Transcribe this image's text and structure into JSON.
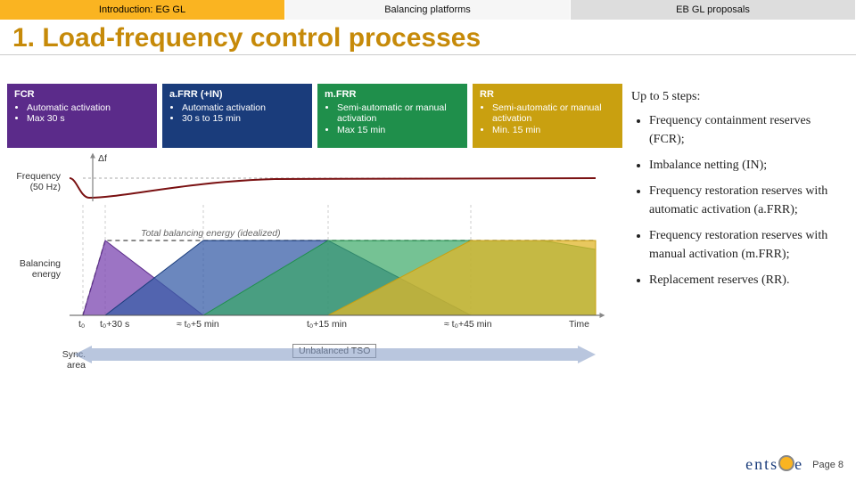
{
  "tabs": {
    "intro": "Introduction: EG GL",
    "balancing": "Balancing platforms",
    "eb": "EB GL proposals"
  },
  "title": "1. Load-frequency control processes",
  "boxes": {
    "fcr": {
      "title": "FCR",
      "b1": "Automatic activation",
      "b2": "Max 30 s"
    },
    "afrr": {
      "title": "a.FRR (+IN)",
      "b1": "Automatic activation",
      "b2": "30 s to 15 min"
    },
    "mfrr": {
      "title": "m.FRR",
      "b1": "Semi-automatic or manual activation",
      "b2": "Max 15 min"
    },
    "rr": {
      "title": "RR",
      "b1": "Semi-automatic or manual activation",
      "b2": "Min. 15 min"
    }
  },
  "diagram": {
    "freq_label": "Frequency (50 Hz)",
    "df_label": "Δf",
    "total_label": "Total balancing energy (idealized)",
    "energy_label": "Balancing energy",
    "sync_label": "Sync. area",
    "unbalanced_label": "Unbalanced TSO",
    "ticks": {
      "t0": "t₀",
      "t30s": "t₀+30 s",
      "t5m": "≈ t₀+5 min",
      "t15m": "t₀+15 min",
      "t45m": "≈ t₀+45 min",
      "time": "Time"
    }
  },
  "steps": {
    "lead": "Up to 5 steps:",
    "s1": "Frequency containment reserves (FCR);",
    "s2": "Imbalance netting (IN);",
    "s3": "Frequency restoration reserves with automatic activation (a.FRR);",
    "s4": "Frequency restoration reserves with manual activation (m.FRR);",
    "s5": "Replacement reserves (RR)."
  },
  "footer": {
    "logo": "ents",
    "page": "Page 8"
  },
  "chart_data": {
    "type": "area",
    "title": "Load-frequency control processes (idealized)",
    "xlabel": "Time",
    "ylabel": "Balancing energy",
    "x_ticks": [
      "t0",
      "t0+30 s",
      "≈ t0+5 min",
      "t0+15 min",
      "≈ t0+45 min"
    ],
    "x_numeric_s": [
      0,
      30,
      300,
      900,
      2700
    ],
    "frequency_deviation": {
      "note": "Δf dips negative at t0 then restores toward 50 Hz",
      "points": [
        {
          "t": 0,
          "df": 0
        },
        {
          "t": 15,
          "df": -1
        },
        {
          "t": 60,
          "df": -0.6
        },
        {
          "t": 300,
          "df": -0.2
        },
        {
          "t": 900,
          "df": 0
        }
      ]
    },
    "series": [
      {
        "name": "FCR",
        "color": "#5b2b8a",
        "shape": [
          {
            "t": 0,
            "v": 0
          },
          {
            "t": 30,
            "v": 1
          },
          {
            "t": 300,
            "v": 0
          }
        ]
      },
      {
        "name": "a.FRR",
        "color": "#1a3c7b",
        "shape": [
          {
            "t": 30,
            "v": 0
          },
          {
            "t": 300,
            "v": 1
          },
          {
            "t": 900,
            "v": 1
          },
          {
            "t": 2700,
            "v": 0
          }
        ]
      },
      {
        "name": "m.FRR",
        "color": "#1f8f4b",
        "shape": [
          {
            "t": 300,
            "v": 0
          },
          {
            "t": 900,
            "v": 1
          },
          {
            "t": 2700,
            "v": 1
          }
        ]
      },
      {
        "name": "RR",
        "color": "#c9a010",
        "shape": [
          {
            "t": 900,
            "v": 0
          },
          {
            "t": 2700,
            "v": 1
          }
        ]
      }
    ],
    "total_envelope": "constant at 1 after initial ramp"
  }
}
